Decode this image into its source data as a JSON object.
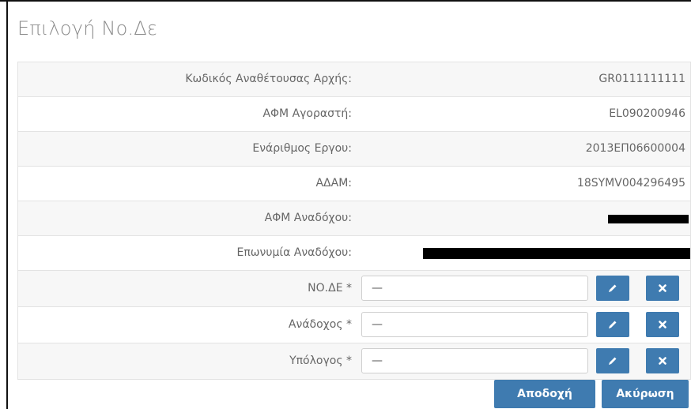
{
  "dialog": {
    "title": "Επιλογή Νο.Δε"
  },
  "info_rows": [
    {
      "label": "Κωδικός Αναθέτουσας Αρχής:",
      "value": "GR0111111111"
    },
    {
      "label": "ΑΦΜ Αγοραστή:",
      "value": "EL090200946"
    },
    {
      "label": "Ενάριθμος Εργου:",
      "value": "2013ΕΠ06600004"
    },
    {
      "label": "ΑΔΑΜ:",
      "value": "18SYMV004296495"
    },
    {
      "label": "ΑΦΜ Αναδόχου:",
      "value": ""
    },
    {
      "label": "Επωνυμία Αναδόχου:",
      "value": ""
    }
  ],
  "input_rows": [
    {
      "label": "ΝΟ.ΔΕ *",
      "value": "—"
    },
    {
      "label": "Ανάδοχος *",
      "value": "—"
    },
    {
      "label": "Υπόλογος *",
      "value": "—"
    }
  ],
  "footer": {
    "accept_label": "Αποδοχή",
    "cancel_label": "Ακύρωση"
  },
  "icons": {
    "edit": "pencil-icon",
    "clear": "close-icon"
  },
  "colors": {
    "button": "#3f7bb0",
    "title": "#8a8a8a",
    "redaction": "#000000"
  }
}
